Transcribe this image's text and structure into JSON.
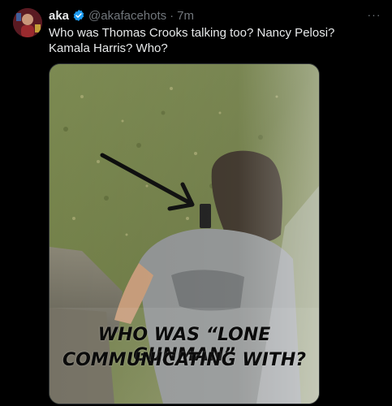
{
  "post": {
    "display_name": "aka",
    "handle": "@akafacehots",
    "separator": "·",
    "time": "7m",
    "text": "Who was Thomas Crooks talking too? Nancy Pelosi? Kamala Harris? Who?",
    "more_label": "···"
  },
  "media": {
    "caption_line1": "WHO WAS “LONE GUNMAN”",
    "caption_line2": "COMMUNICATING WITH?"
  },
  "icons": {
    "verified": "verified-badge-icon",
    "more": "more-options-icon"
  },
  "colors": {
    "background": "#000000",
    "verified": "#1d9bf0",
    "secondary_text": "#71767b"
  }
}
